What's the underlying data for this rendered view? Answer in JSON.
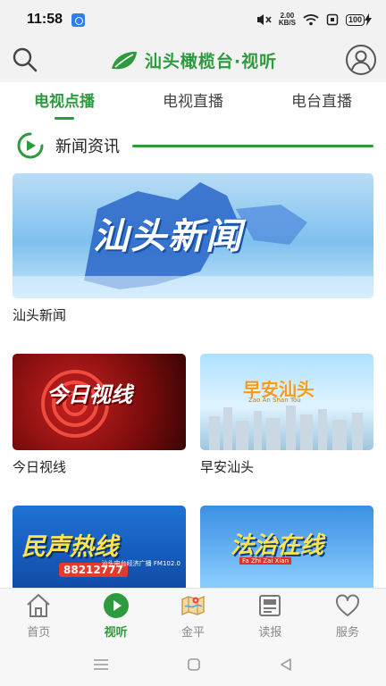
{
  "status_bar": {
    "time": "11:58",
    "net_speed_value": "2.00",
    "net_speed_unit": "KB/S",
    "battery": "100"
  },
  "header": {
    "title": "汕头橄榄台·视听",
    "search_icon": "search-icon",
    "user_icon": "user-avatar-icon",
    "brand_color": "#2e9a3e"
  },
  "tabs": [
    {
      "label": "电视点播",
      "active": true
    },
    {
      "label": "电视直播",
      "active": false
    },
    {
      "label": "电台直播",
      "active": false
    }
  ],
  "section": {
    "title": "新闻资讯"
  },
  "programs": [
    {
      "label": "汕头新闻",
      "thumb_text": "汕头新闻"
    },
    {
      "label": "今日视线",
      "thumb_text": "今日视线"
    },
    {
      "label": "早安汕头",
      "thumb_text": "早安汕头",
      "thumb_sub": "Zao An Shan Tou"
    },
    {
      "label": "民声热线",
      "thumb_text": "民声热线",
      "thumb_phone": "88212777",
      "thumb_station": "汕头电台经济广播 FM102.0"
    },
    {
      "label": "法治在线",
      "thumb_text": "法治在线",
      "thumb_sub": "Fa Zhi Zai Xian"
    }
  ],
  "bottom_nav": [
    {
      "label": "首页",
      "icon": "home-icon",
      "active": false
    },
    {
      "label": "视听",
      "icon": "play-icon",
      "active": true
    },
    {
      "label": "金平",
      "icon": "map-icon",
      "active": false
    },
    {
      "label": "读报",
      "icon": "newspaper-icon",
      "active": false
    },
    {
      "label": "服务",
      "icon": "heart-icon",
      "active": false
    }
  ]
}
